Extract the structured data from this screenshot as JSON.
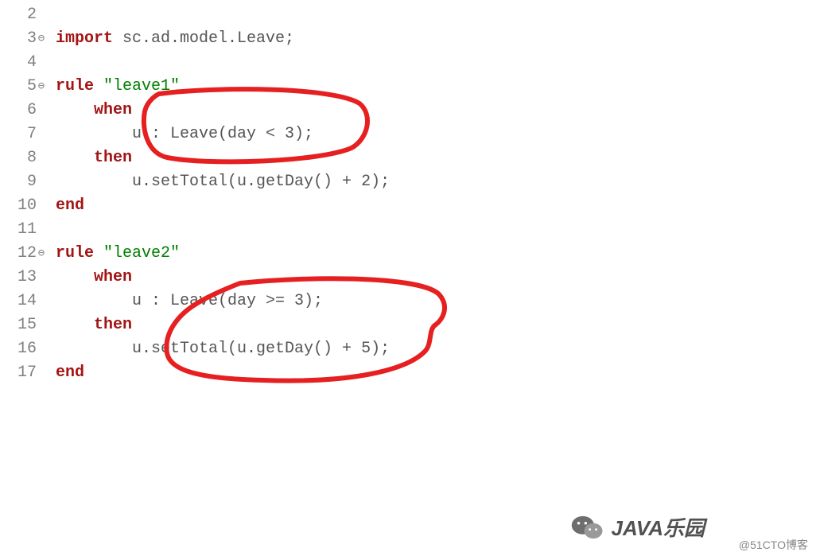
{
  "lines": [
    {
      "num": "2",
      "fold": false,
      "tokens": []
    },
    {
      "num": "3",
      "fold": true,
      "tokens": [
        {
          "t": "kw",
          "v": "import"
        },
        {
          "t": "txt",
          "v": " sc.ad.model.Leave;"
        }
      ]
    },
    {
      "num": "4",
      "fold": false,
      "tokens": []
    },
    {
      "num": "5",
      "fold": true,
      "tokens": [
        {
          "t": "kw",
          "v": "rule"
        },
        {
          "t": "txt",
          "v": " "
        },
        {
          "t": "str",
          "v": "\"leave1\""
        }
      ]
    },
    {
      "num": "6",
      "fold": false,
      "tokens": [
        {
          "t": "txt",
          "v": "    "
        },
        {
          "t": "kw",
          "v": "when"
        }
      ]
    },
    {
      "num": "7",
      "fold": false,
      "tokens": [
        {
          "t": "txt",
          "v": "        u : Leave(day < 3);"
        }
      ]
    },
    {
      "num": "8",
      "fold": false,
      "tokens": [
        {
          "t": "txt",
          "v": "    "
        },
        {
          "t": "kw",
          "v": "then"
        }
      ]
    },
    {
      "num": "9",
      "fold": false,
      "tokens": [
        {
          "t": "txt",
          "v": "        u.setTotal(u.getDay() + 2);"
        }
      ]
    },
    {
      "num": "10",
      "fold": false,
      "tokens": [
        {
          "t": "kw",
          "v": "end"
        }
      ]
    },
    {
      "num": "11",
      "fold": false,
      "tokens": []
    },
    {
      "num": "12",
      "fold": true,
      "tokens": [
        {
          "t": "kw",
          "v": "rule"
        },
        {
          "t": "txt",
          "v": " "
        },
        {
          "t": "str",
          "v": "\"leave2\""
        }
      ]
    },
    {
      "num": "13",
      "fold": false,
      "tokens": [
        {
          "t": "txt",
          "v": "    "
        },
        {
          "t": "kw",
          "v": "when"
        }
      ]
    },
    {
      "num": "14",
      "fold": false,
      "tokens": [
        {
          "t": "txt",
          "v": "        u : Leave(day >= 3);"
        }
      ]
    },
    {
      "num": "15",
      "fold": false,
      "tokens": [
        {
          "t": "txt",
          "v": "    "
        },
        {
          "t": "kw",
          "v": "then"
        }
      ]
    },
    {
      "num": "16",
      "fold": false,
      "tokens": [
        {
          "t": "txt",
          "v": "        u.setTotal(u.getDay() + 5);"
        }
      ]
    },
    {
      "num": "17",
      "fold": false,
      "tokens": [
        {
          "t": "kw",
          "v": "end"
        }
      ]
    }
  ],
  "watermark": {
    "logo_text": "JAVA乐园",
    "cto_text": "@51CTO博客"
  }
}
